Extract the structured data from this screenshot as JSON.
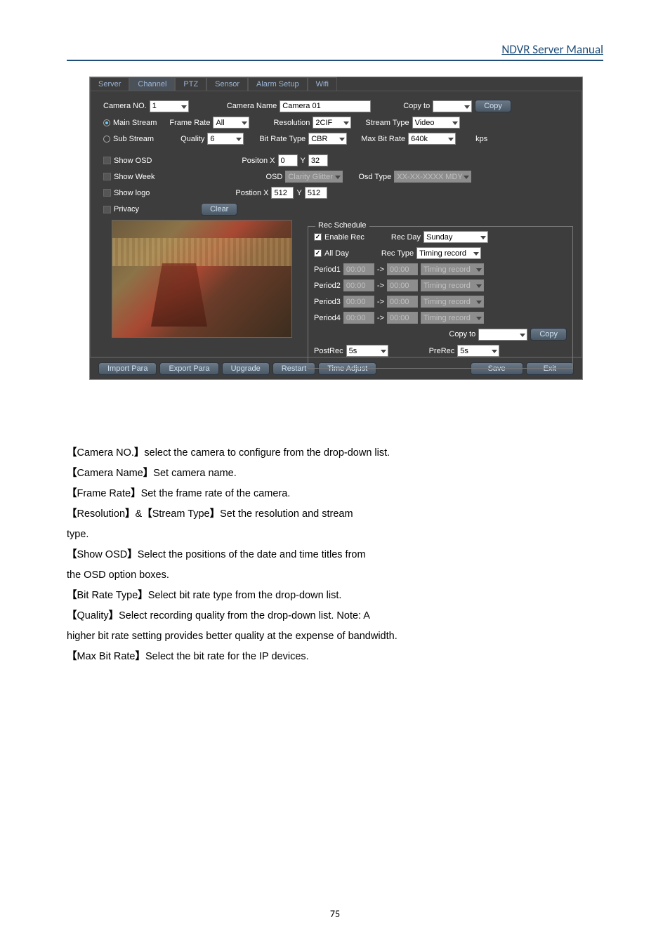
{
  "doc": {
    "header": "NDVR Server Manual",
    "page_number": "75"
  },
  "tabs": [
    "Server",
    "Channel",
    "PTZ",
    "Sensor",
    "Alarm Setup",
    "Wifi"
  ],
  "active_tab": 1,
  "top": {
    "camera_no_lbl": "Camera NO.",
    "camera_no": "1",
    "camera_name_lbl": "Camera Name",
    "camera_name": "Camera 01",
    "copy_to_lbl": "Copy to",
    "copy_to": "",
    "copy_btn": "Copy"
  },
  "main_stream": {
    "label": "Main Stream",
    "frame_rate_lbl": "Frame Rate",
    "frame_rate": "All",
    "resolution_lbl": "Resolution",
    "resolution": "2CIF",
    "stream_type_lbl": "Stream Type",
    "stream_type": "Video"
  },
  "sub_stream": {
    "label": "Sub Stream",
    "quality_lbl": "Quality",
    "quality": "6",
    "bitrate_type_lbl": "Bit Rate Type",
    "bitrate_type": "CBR",
    "max_bitrate_lbl": "Max Bit Rate",
    "max_bitrate": "640k",
    "kps": "kps"
  },
  "osd": {
    "show_osd": "Show OSD",
    "show_week": "Show Week",
    "show_logo": "Show logo",
    "privacy": "Privacy",
    "clear": "Clear",
    "position_x_lbl": "Positon X",
    "pos_x": "0",
    "y_lbl": "Y",
    "pos_y": "32",
    "osd_lbl": "OSD",
    "osd_val": "Clarity Glitter",
    "osd_type_lbl": "Osd Type",
    "osd_type": "XX-XX-XXXX MDY",
    "postion_x2_lbl": "Postion X",
    "pos_x2": "512",
    "pos_y2": "512"
  },
  "rec": {
    "legend": "Rec Schedule",
    "enable_rec": "Enable Rec",
    "all_day": "All Day",
    "rec_day_lbl": "Rec Day",
    "rec_day": "Sunday",
    "rec_type_lbl": "Rec Type",
    "rec_type": "Timing record",
    "periods": [
      {
        "lbl": "Period1",
        "start": "00:00",
        "end": "00:00",
        "type": "Timing record"
      },
      {
        "lbl": "Period2",
        "start": "00:00",
        "end": "00:00",
        "type": "Timing record"
      },
      {
        "lbl": "Period3",
        "start": "00:00",
        "end": "00:00",
        "type": "Timing record"
      },
      {
        "lbl": "Period4",
        "start": "00:00",
        "end": "00:00",
        "type": "Timing record"
      }
    ],
    "arrow": "->",
    "copy_to_lbl": "Copy to",
    "copy_btn": "Copy",
    "postrec_lbl": "PostRec",
    "postrec": "5s",
    "prerec_lbl": "PreRec",
    "prerec": "5s"
  },
  "footer": {
    "import": "Import Para",
    "export": "Export Para",
    "upgrade": "Upgrade",
    "restart": "Restart",
    "time_adjust": "Time Adjust",
    "save": "Save",
    "exit": "Exit"
  },
  "text": {
    "l1a": "Camera NO.",
    "l1b": "select the camera to configure from the drop-down list.",
    "l2a": "Camera Name",
    "l2b": "Set camera name.",
    "l3a": "Frame Rate",
    "l3b": "Set the frame rate of the camera.",
    "l4a": "Resolution",
    "l4m": "&",
    "l4b": "Stream Type",
    "l4c": "Set the resolution and stream",
    "l4c2": "type.",
    "l5a": "Show OSD",
    "l5b": "Select the positions of the date and time titles from",
    "l5c": "the OSD option boxes.",
    "l6a": "Bit Rate Type",
    "l6b": "Select bit rate type from the drop-down list.",
    "l7a": "Quality",
    "l7b": "Select recording quality from the drop-down list. Note: A",
    "l7c": "higher bit rate setting provides better quality at the expense of bandwidth.",
    "l8a": "Max Bit Rate",
    "l8b": "Select the bit rate for the IP devices."
  }
}
